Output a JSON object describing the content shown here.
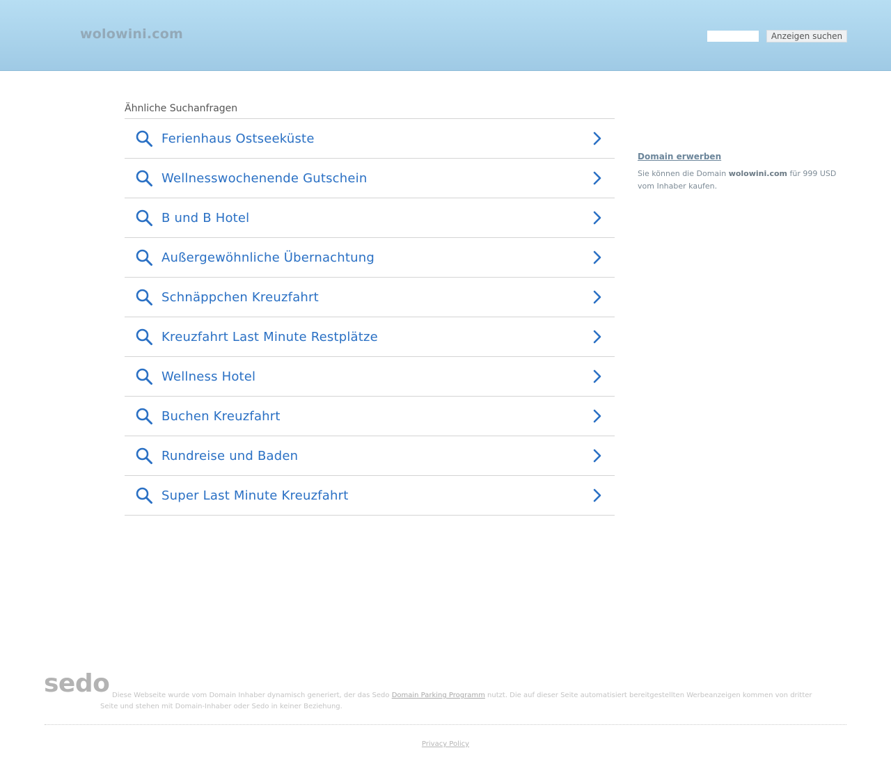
{
  "header": {
    "site_title": "wolowini.com",
    "search_placeholder": "",
    "search_button": "Anzeigen suchen"
  },
  "related": {
    "heading": "Ähnliche Suchanfragen",
    "items": [
      {
        "label": "Ferienhaus Ostseeküste"
      },
      {
        "label": "Wellnesswochenende Gutschein"
      },
      {
        "label": "B und B Hotel"
      },
      {
        "label": "Außergewöhnliche Übernachtung"
      },
      {
        "label": "Schnäppchen Kreuzfahrt"
      },
      {
        "label": "Kreuzfahrt Last Minute Restplätze"
      },
      {
        "label": "Wellness Hotel"
      },
      {
        "label": "Buchen Kreuzfahrt"
      },
      {
        "label": "Rundreise und Baden"
      },
      {
        "label": "Super Last Minute Kreuzfahrt"
      }
    ]
  },
  "sidebar": {
    "buy_link": "Domain erwerben",
    "text_prefix": "Sie können die Domain",
    "domain": "wolowini.com",
    "text_suffix": "für 999 USD vom Inhaber kaufen."
  },
  "footer": {
    "logo": "sedo",
    "disclaimer_part1": "Diese Webseite wurde vom Domain Inhaber dynamisch generiert, der das Sedo",
    "disclaimer_link": "Domain Parking Programm",
    "disclaimer_part2": "nutzt. Die auf dieser Seite automatisiert bereitgestellten Werbeanzeigen kommen von dritter Seite und stehen mit Domain-Inhaber oder Sedo in keiner Beziehung.",
    "privacy": "Privacy Policy"
  },
  "colors": {
    "header_top": "#b7def3",
    "header_bottom": "#9fcae5",
    "link_blue": "#2a70c4"
  },
  "icons": {
    "result_icon": "search-icon",
    "result_arrow": "chevron-right-icon"
  }
}
